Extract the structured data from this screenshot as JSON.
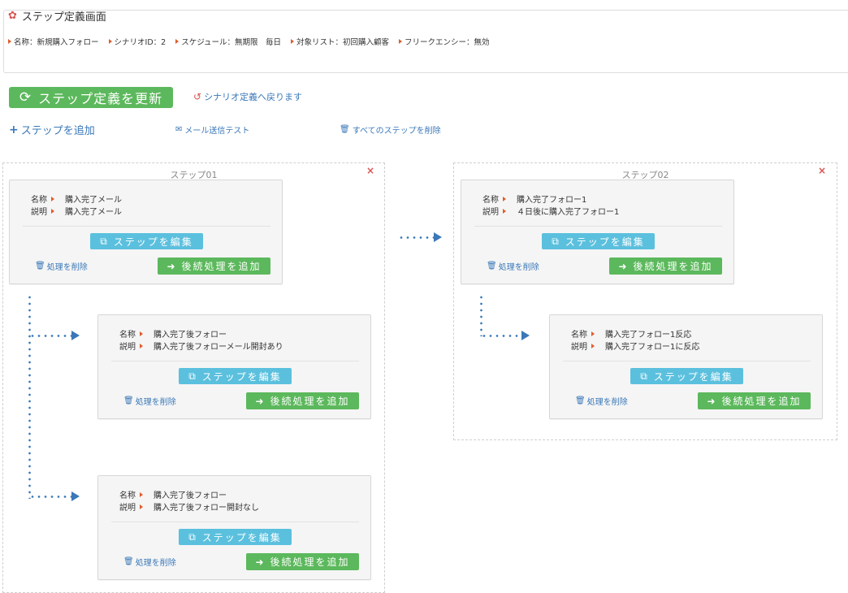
{
  "header": {
    "title": "ステップ定義画面",
    "meta": [
      {
        "label": "名称：新規購入フォロー"
      },
      {
        "label": "シナリオID：2"
      },
      {
        "label": "スケジュール：無期限　毎日"
      },
      {
        "label": "対象リスト：初回購入顧客"
      },
      {
        "label": "フリークエンシー：無効"
      }
    ]
  },
  "toolbar": {
    "update_label": "ステップ定義を更新",
    "back_label": "シナリオ定義へ戻ります",
    "add_step_label": "ステップを追加",
    "mail_test_label": "メール送信テスト",
    "delete_all_label": "すべてのステップを削除"
  },
  "common": {
    "name_label": "名称",
    "desc_label": "説明",
    "edit_label": "ステップを編集",
    "add_next_label": "後続処理を追加",
    "delete_proc_label": "処理を削除",
    "close_glyph": "×"
  },
  "steps": [
    {
      "title": "ステップ01",
      "cards": [
        {
          "name": "購入完了メール",
          "desc": "購入完了メール"
        },
        {
          "name": "購入完了後フォロー",
          "desc": "購入完了後フォローメール開封あり"
        },
        {
          "name": "購入完了後フォロー",
          "desc": "購入完了後フォロー開封なし"
        }
      ]
    },
    {
      "title": "ステップ02",
      "cards": [
        {
          "name": "購入完了フォロー1",
          "desc": "４日後に購入完了フォロー1"
        },
        {
          "name": "購入完了フォロー1反応",
          "desc": "購入完了フォロー1に反応"
        }
      ]
    }
  ],
  "colors": {
    "success": "#5cb85c",
    "info": "#5bc0de",
    "link": "#3a78b8",
    "danger": "#d9534f"
  }
}
